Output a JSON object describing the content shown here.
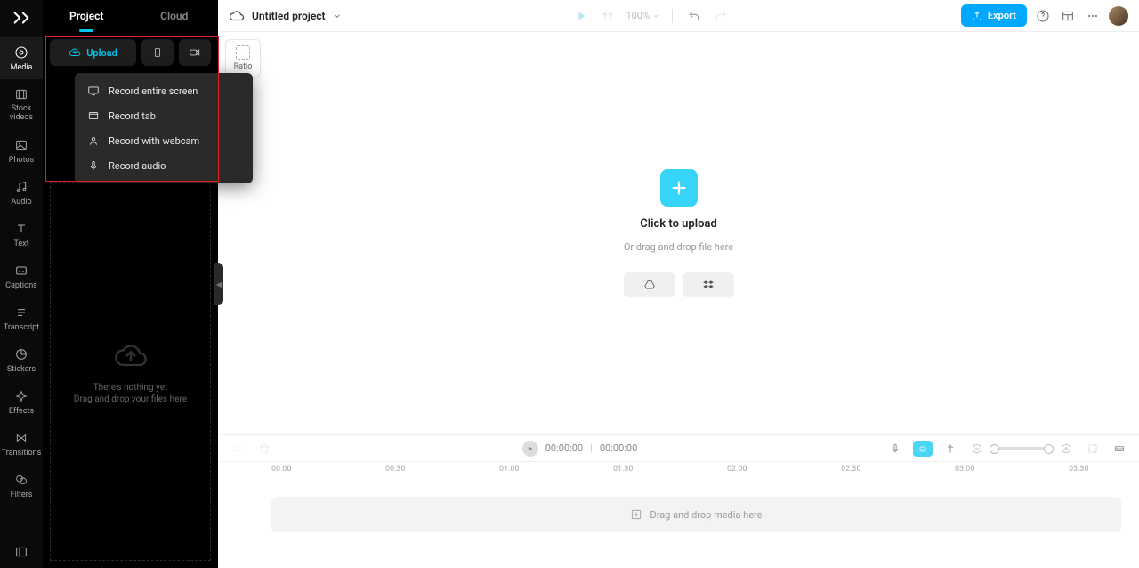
{
  "rail": {
    "items": [
      {
        "label": "Media"
      },
      {
        "label": "Stock videos"
      },
      {
        "label": "Photos"
      },
      {
        "label": "Audio"
      },
      {
        "label": "Text"
      },
      {
        "label": "Captions"
      },
      {
        "label": "Transcript"
      },
      {
        "label": "Stickers"
      },
      {
        "label": "Effects"
      },
      {
        "label": "Transitions"
      },
      {
        "label": "Filters"
      }
    ]
  },
  "tabs": {
    "project": "Project",
    "cloud": "Cloud"
  },
  "upload": {
    "label": "Upload"
  },
  "dropdown": {
    "items": [
      "Record entire screen",
      "Record tab",
      "Record with webcam",
      "Record audio"
    ]
  },
  "empty": {
    "line1": "There's nothing yet",
    "line2": "Drag and drop your files here"
  },
  "topbar": {
    "project_name": "Untitled project",
    "zoom": "100%",
    "export": "Export"
  },
  "ratio": {
    "label": "Ratio"
  },
  "canvas": {
    "title": "Click to upload",
    "subtitle": "Or drag and drop file here"
  },
  "playback": {
    "current": "00:00:00",
    "sep": "|",
    "total": "00:00:00"
  },
  "ruler": {
    "ticks": [
      "00:00",
      "00:30",
      "01:00",
      "01:30",
      "02:00",
      "02:30",
      "03:00",
      "03:30"
    ]
  },
  "track": {
    "hint": "Drag and drop media here"
  }
}
